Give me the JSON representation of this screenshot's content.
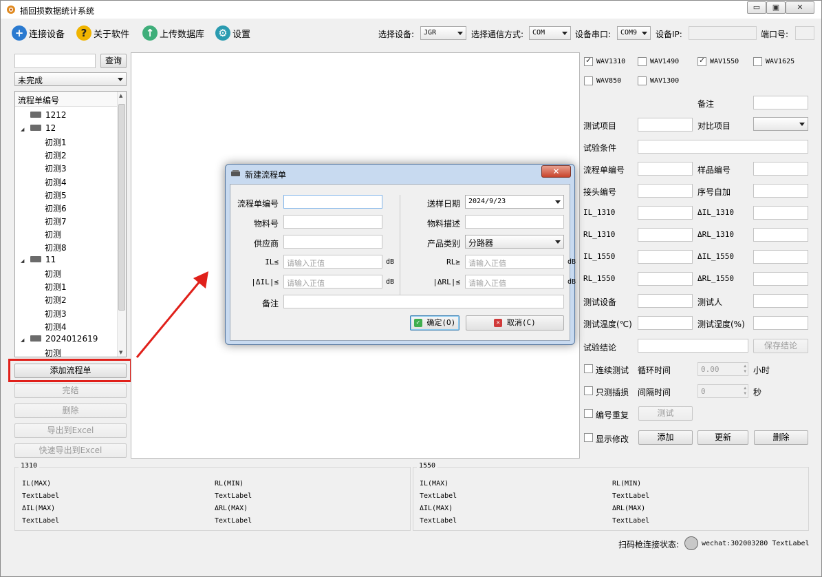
{
  "window": {
    "title": "插回损数据统计系统",
    "minimize": "▭",
    "restore": "▣",
    "close": "✕"
  },
  "toolbar": {
    "connect_label": "连接设备",
    "about_label": "关于软件",
    "upload_label": "上传数据库",
    "settings_label": "设置",
    "device_label": "选择设备:",
    "device_value": "JGR",
    "comm_label": "选择通信方式:",
    "comm_value": "COM",
    "port_label": "设备串口:",
    "port_value": "COM9",
    "ip_label": "设备IP:",
    "ip_value": "",
    "portnum_label": "端口号:",
    "portnum_value": ""
  },
  "left": {
    "search_value": "",
    "query_button": "查询",
    "status_filter": "未完成",
    "tree_header": "流程单编号",
    "tree": [
      {
        "label": "1212",
        "level": 0,
        "icon": "drive-icon"
      },
      {
        "label": "12",
        "level": 0,
        "icon": "drive-icon",
        "expanded": true
      },
      {
        "label": "初测1",
        "level": 1
      },
      {
        "label": "初测2",
        "level": 1
      },
      {
        "label": "初测3",
        "level": 1
      },
      {
        "label": "初测4",
        "level": 1
      },
      {
        "label": "初测5",
        "level": 1
      },
      {
        "label": "初测6",
        "level": 1
      },
      {
        "label": "初测7",
        "level": 1
      },
      {
        "label": "初测",
        "level": 1
      },
      {
        "label": "初测8",
        "level": 1
      },
      {
        "label": "11",
        "level": 0,
        "icon": "drive-icon",
        "expanded": true
      },
      {
        "label": "初测",
        "level": 1
      },
      {
        "label": "初测1",
        "level": 1
      },
      {
        "label": "初测2",
        "level": 1
      },
      {
        "label": "初测3",
        "level": 1
      },
      {
        "label": "初测4",
        "level": 1
      },
      {
        "label": "2024012619",
        "level": 0,
        "icon": "drive-icon",
        "expanded": true
      },
      {
        "label": "初测",
        "level": 1
      }
    ],
    "add_button": "添加流程单",
    "finish_button": "完结",
    "delete_button": "删除",
    "export_button": "导出到Excel",
    "quick_export_button": "快速导出到Excel"
  },
  "right": {
    "checkboxes": [
      {
        "label": "WAV1310",
        "checked": true
      },
      {
        "label": "WAV1490",
        "checked": false
      },
      {
        "label": "WAV1550",
        "checked": true
      },
      {
        "label": "WAV1625",
        "checked": false
      },
      {
        "label": "WAV850",
        "checked": false
      },
      {
        "label": "WAV1300",
        "checked": false
      }
    ],
    "remark_label": "备注",
    "test_item_label": "测试项目",
    "compare_item_label": "对比项目",
    "condition_label": "试验条件",
    "flow_no_label": "流程单编号",
    "sample_no_label": "样品编号",
    "connector_no_label": "接头编号",
    "serial_auto_label": "序号自加",
    "il1310_label": "IL_1310",
    "dil1310_label": "ΔIL_1310",
    "rl1310_label": "RL_1310",
    "drl1310_label": "ΔRL_1310",
    "il1550_label": "IL_1550",
    "dil1550_label": "ΔIL_1550",
    "rl1550_label": "RL_1550",
    "drl1550_label": "ΔRL_1550",
    "test_device_label": "测试设备",
    "tester_label": "测试人",
    "test_temp_label": "测试温度(℃)",
    "test_humidity_label": "测试湿度(%)",
    "conclusion_label": "试验结论",
    "save_conclusion_button": "保存结论",
    "continuous_label": "连续测试",
    "cycle_label": "循环时间",
    "cycle_value": "0.00",
    "hour_label": "小时",
    "il_only_label": "只测插损",
    "interval_label": "间隔时间",
    "interval_value": "0",
    "second_label": "秒",
    "repeat_no_label": "编号重复",
    "test_button": "测试",
    "show_edit_label": "显示修改",
    "add_button": "添加",
    "update_button": "更新",
    "delete_button": "删除"
  },
  "stats": {
    "left_title": "1310",
    "right_title": "1550",
    "il_max": "IL(MAX)",
    "rl_min": "RL(MIN)",
    "dil_max": "ΔIL(MAX)",
    "drl_max": "ΔRL(MAX)",
    "text_label": "TextLabel"
  },
  "status_bar": {
    "scanner_label": "扫码枪连接状态:",
    "wechat": "wechat:302003280 TextLabel"
  },
  "dialog": {
    "title": "新建流程单",
    "close": "✕",
    "flow_no_label": "流程单编号",
    "flow_no_value": "",
    "material_no_label": "物料号",
    "supplier_label": "供应商",
    "il_label": "IL≤",
    "dil_label": "|ΔIL|≤",
    "placeholder": "请输入正值",
    "unit": "dB",
    "remark_label": "备注",
    "send_date_label": "送样日期",
    "send_date_value": "2024/9/23",
    "material_desc_label": "物料描述",
    "product_type_label": "产品类别",
    "product_type_value": "分路器",
    "rl_label": "RL≥",
    "drl_label": "|ΔRL|≤",
    "ok_button": "确定(O)",
    "cancel_button": "取消(C)"
  }
}
